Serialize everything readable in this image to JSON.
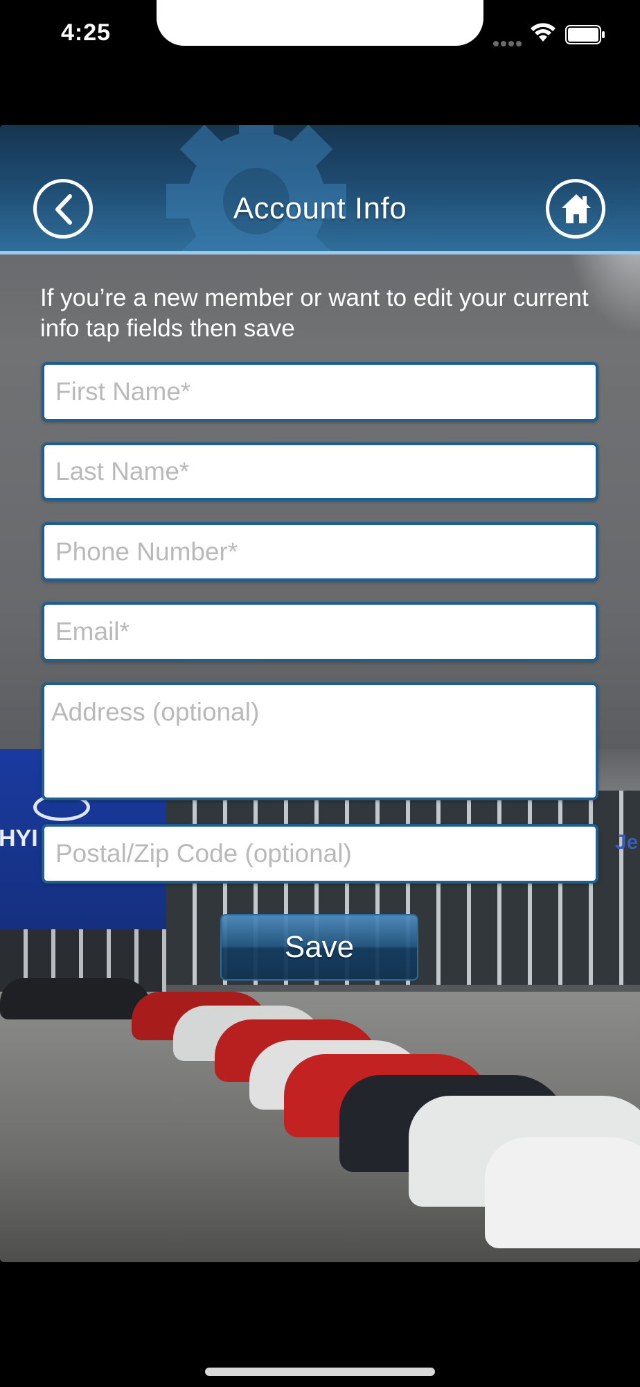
{
  "status_bar": {
    "time": "4:25"
  },
  "header": {
    "title": "Account Info",
    "back_icon": "chevron-left-icon",
    "home_icon": "home-icon"
  },
  "form": {
    "instructions": "If you’re a new member or want to edit your current info tap fields then save",
    "first_name": {
      "placeholder": "First Name*",
      "value": ""
    },
    "last_name": {
      "placeholder": "Last Name*",
      "value": ""
    },
    "phone": {
      "placeholder": "Phone Number*",
      "value": ""
    },
    "email": {
      "placeholder": "Email*",
      "value": ""
    },
    "address": {
      "placeholder": "Address (optional)",
      "value": ""
    },
    "postal": {
      "placeholder": "Postal/Zip Code (optional)",
      "value": ""
    },
    "save_label": "Save"
  },
  "background": {
    "sign_left": "HYI",
    "sign_right": "Je"
  },
  "colors": {
    "header": "#1e4a6f",
    "field_border": "#1f5f8f",
    "placeholder": "#b9b9b9"
  }
}
